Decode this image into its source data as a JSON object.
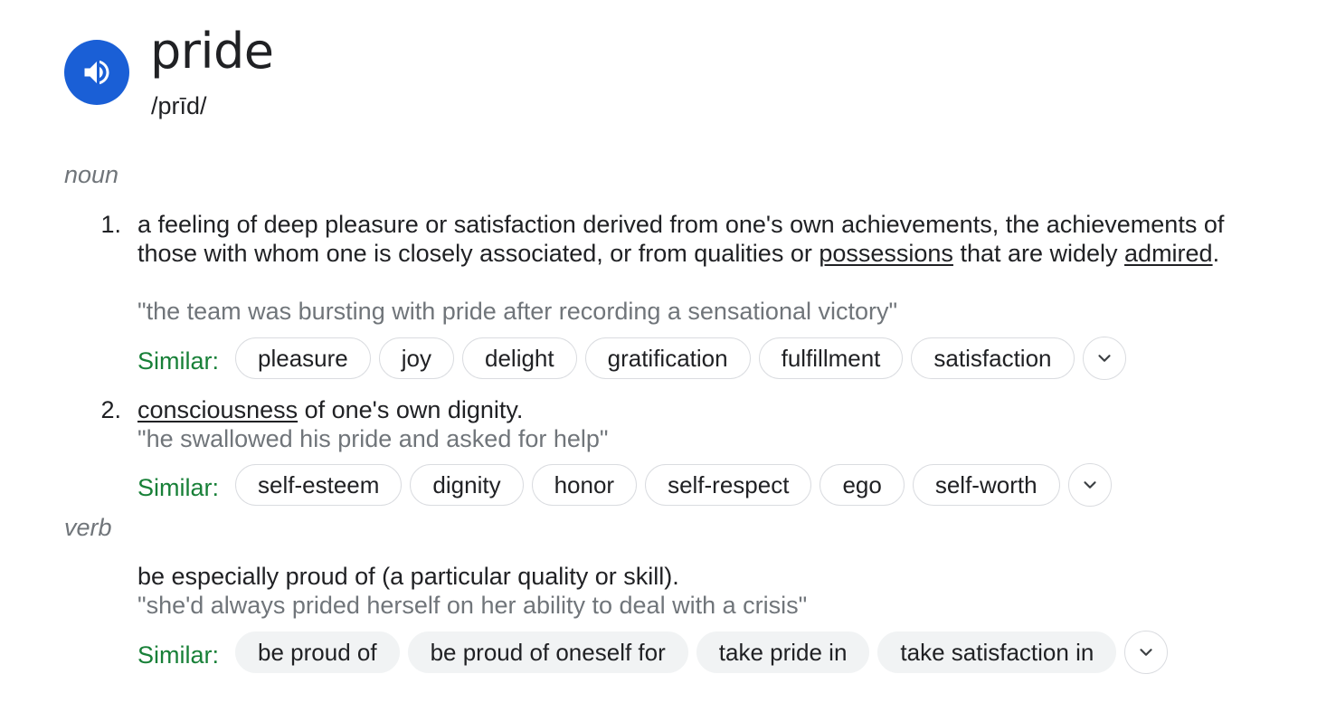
{
  "entry": {
    "word": "pride",
    "phonetic": "/prīd/"
  },
  "icons": {
    "audio": "speaker-icon",
    "expand": "chevron-down-icon"
  },
  "colors": {
    "audio_button": "#1a5fd6",
    "similar_label": "#188038",
    "example_text": "#70757a",
    "chip_border": "#dadce0",
    "chip_fill": "#f1f3f4"
  },
  "noun": {
    "label": "noun",
    "senses": [
      {
        "number": "1.",
        "definition_parts": [
          "a feeling of deep pleasure or satisfaction derived from one's own achievements, the achievements of those with whom one is closely associated, or from qualities or ",
          "possessions",
          " that are widely ",
          "admired",
          "."
        ],
        "example": "\"the team was bursting with pride after recording a sensational victory\"",
        "similar_label": "Similar:",
        "similar": [
          "pleasure",
          "joy",
          "delight",
          "gratification",
          "fulfillment",
          "satisfaction"
        ]
      },
      {
        "number": "2.",
        "definition_parts": [
          "consciousness",
          " of one's own dignity."
        ],
        "example": "\"he swallowed his pride and asked for help\"",
        "similar_label": "Similar:",
        "similar": [
          "self-esteem",
          "dignity",
          "honor",
          "self-respect",
          "ego",
          "self-worth"
        ]
      }
    ]
  },
  "verb": {
    "label": "verb",
    "senses": [
      {
        "definition": "be especially proud of (a particular quality or skill).",
        "example": "\"she'd always prided herself on her ability to deal with a crisis\"",
        "similar_label": "Similar:",
        "similar": [
          "be proud of",
          "be proud of oneself for",
          "take pride in",
          "take satisfaction in"
        ]
      }
    ]
  }
}
